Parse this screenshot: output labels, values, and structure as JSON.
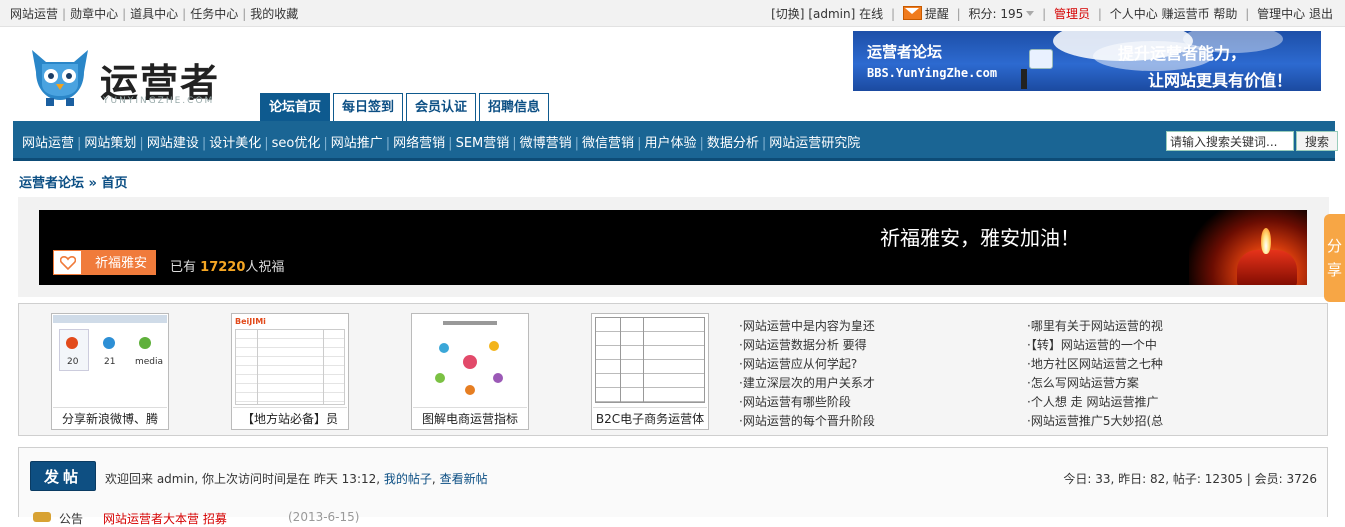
{
  "topbar": {
    "left_links": [
      "网站运营",
      "勋章中心",
      "道具中心",
      "任务中心",
      "我的收藏"
    ],
    "switch": "[切换]",
    "user": "[admin]",
    "online": "在线",
    "remind": "提醒",
    "points": "积分: 195",
    "admin_role": "管理员",
    "right_links": [
      "个人中心",
      "赚运营币",
      "帮助",
      "管理中心",
      "退出"
    ]
  },
  "logo": {
    "title": "运营者",
    "subtitle": "YUNYINGZHE.COM"
  },
  "banner": {
    "forum_name": "运营者论坛",
    "url_text": "BBS.YunYingZhe.com",
    "slogan1": "提升运营者能力，",
    "slogan2": "让网站更具有价值！"
  },
  "tabs": [
    {
      "label": "论坛首页",
      "active": true
    },
    {
      "label": "每日签到",
      "active": false
    },
    {
      "label": "会员认证",
      "active": false
    },
    {
      "label": "招聘信息",
      "active": false
    }
  ],
  "nav": {
    "items": [
      "网站运营",
      "网站策划",
      "网站建设",
      "设计美化",
      "seo优化",
      "网站推广",
      "网络营销",
      "SEM营销",
      "微博营销",
      "微信营销",
      "用户体验",
      "数据分析",
      "网站运营研究院"
    ],
    "search_placeholder": "请输入搜索关键词...",
    "search_button": "搜索"
  },
  "breadcrumb": {
    "home": "运营者论坛",
    "arrow": "»",
    "current": "首页"
  },
  "prayer": {
    "headline": "祈福雅安，雅安加油！",
    "button": "祈福雅安",
    "count_prefix": "已有",
    "count": "17220",
    "count_suffix": "人祝福"
  },
  "share_tab": [
    "分",
    "享"
  ],
  "thumbnails": [
    {
      "caption": "分享新浪微博、腾",
      "icon_labels": [
        "20",
        "21",
        "media"
      ]
    },
    {
      "caption": "【地方站必备】员",
      "brand": "BeiJIMi"
    },
    {
      "caption": "图解电商运营指标"
    },
    {
      "caption": "B2C电子商务运营体"
    }
  ],
  "list_left": [
    "·网站运营中是内容为皇还",
    "·网站运营数据分析 要得",
    "·网站运营应从何学起?",
    "·建立深层次的用户关系才",
    "·网站运营有哪些阶段",
    "·网站运营的每个晋升阶段"
  ],
  "list_right": [
    "·哪里有关于网站运营的视",
    "·【转】网站运营的一个中",
    "·地方社区网站运营之七种",
    "·怎么写网站运营方案",
    "·个人想 走 网站运营推广",
    "·网站运营推广5大妙招(总"
  ],
  "welcome": {
    "post_button": "发帖",
    "message": "欢迎回来 admin, 你上次访问时间是在 昨天 13:12,",
    "my_posts": "我的帖子",
    "new_posts": "查看新帖",
    "stats": "今日: 33, 昨日: 82, 帖子: 12305 | 会员: 3726",
    "notice_label": "公告",
    "notice_link": "网站运营者大本营 招募",
    "notice_date": "(2013-6-15)"
  },
  "colors": {
    "nav_bg": "#1a6594",
    "tab_active": "#0e5a8f",
    "accent_orange": "#f07b3b",
    "admin_red": "#d50000"
  }
}
